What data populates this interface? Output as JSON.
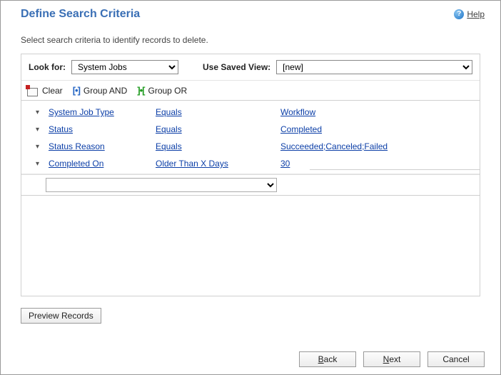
{
  "header": {
    "title": "Define Search Criteria",
    "help_label": "Help"
  },
  "subtext": "Select search criteria to identify records to delete.",
  "lookfor": {
    "label": "Look for:",
    "value": "System Jobs"
  },
  "savedview": {
    "label": "Use Saved View:",
    "value": "[new]"
  },
  "toolbar": {
    "clear": "Clear",
    "group_and": "Group AND",
    "group_or": "Group OR"
  },
  "rows": [
    {
      "field": "System Job Type",
      "operator": "Equals",
      "value": "Workflow"
    },
    {
      "field": "Status",
      "operator": "Equals",
      "value": "Completed"
    },
    {
      "field": "Status Reason",
      "operator": "Equals",
      "value": "Succeeded;Canceled;Failed"
    },
    {
      "field": "Completed On",
      "operator": "Older Than X Days",
      "value": "30"
    }
  ],
  "preview_label": "Preview Records",
  "buttons": {
    "back": "Back",
    "next": "Next",
    "cancel": "Cancel"
  }
}
